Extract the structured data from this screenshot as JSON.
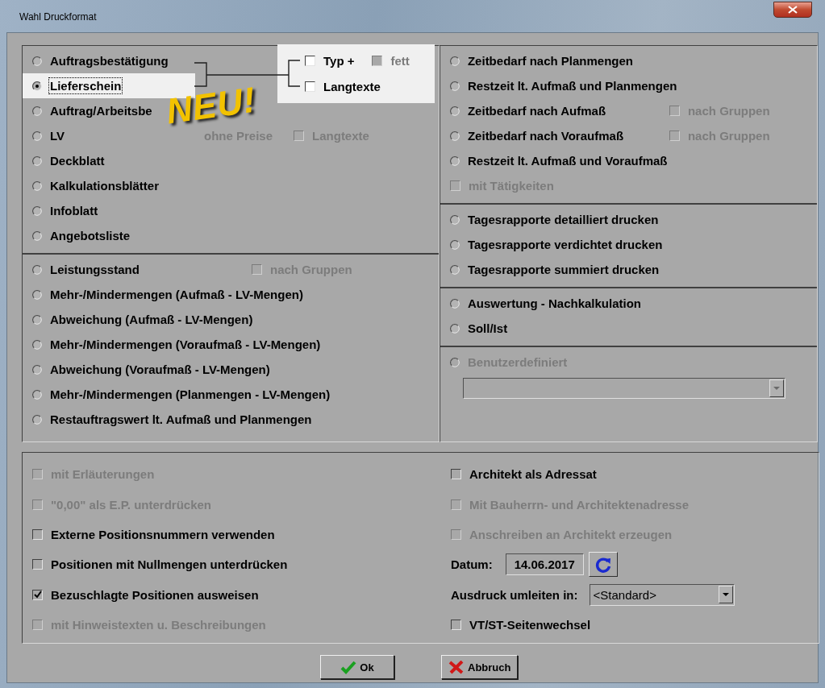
{
  "window": {
    "title": "Wahl Druckformat"
  },
  "left_sections": [
    {
      "rows": [
        {
          "kind": "radio",
          "label": "Auftragsbestätigung",
          "selected": false,
          "focused": false,
          "disabled": false
        },
        {
          "kind": "radio",
          "label": "Lieferschein",
          "selected": true,
          "focused": true,
          "disabled": false
        },
        {
          "kind": "radio",
          "label": "Auftrag/Arbeitsbe",
          "selected": false,
          "focused": false,
          "disabled": false
        },
        {
          "kind": "radio",
          "label": "LV",
          "selected": false,
          "focused": false,
          "disabled": false,
          "extras": [
            {
              "kind": "text",
              "label": "ohne Preise",
              "disabled": true
            },
            {
              "kind": "checkbox",
              "label": "Langtexte",
              "checked": false,
              "disabled": true
            }
          ]
        },
        {
          "kind": "radio",
          "label": "Deckblatt",
          "selected": false,
          "focused": false,
          "disabled": false
        },
        {
          "kind": "radio",
          "label": "Kalkulationsblätter",
          "selected": false,
          "focused": false,
          "disabled": false
        },
        {
          "kind": "radio",
          "label": "Infoblatt",
          "selected": false,
          "focused": false,
          "disabled": false
        },
        {
          "kind": "radio",
          "label": "Angebotsliste",
          "selected": false,
          "focused": false,
          "disabled": false
        }
      ]
    },
    {
      "rows": [
        {
          "kind": "radio",
          "label": "Leistungsstand",
          "selected": false,
          "focused": false,
          "disabled": false,
          "extras": [
            {
              "kind": "checkbox",
              "label": "nach Gruppen",
              "checked": false,
              "disabled": true
            }
          ]
        },
        {
          "kind": "radio",
          "label": "Mehr-/Mindermengen (Aufmaß - LV-Mengen)",
          "selected": false,
          "focused": false,
          "disabled": false
        },
        {
          "kind": "radio",
          "label": "Abweichung (Aufmaß - LV-Mengen)",
          "selected": false,
          "focused": false,
          "disabled": false
        },
        {
          "kind": "radio",
          "label": "Mehr-/Mindermengen (Voraufmaß - LV-Mengen)",
          "selected": false,
          "focused": false,
          "disabled": false
        },
        {
          "kind": "radio",
          "label": "Abweichung (Voraufmaß - LV-Mengen)",
          "selected": false,
          "focused": false,
          "disabled": false
        },
        {
          "kind": "radio",
          "label": "Mehr-/Mindermengen (Planmengen - LV-Mengen)",
          "selected": false,
          "focused": false,
          "disabled": false
        },
        {
          "kind": "radio",
          "label": "Restauftragswert lt. Aufmaß und Planmengen",
          "selected": false,
          "focused": false,
          "disabled": false
        }
      ]
    }
  ],
  "right_sections": [
    {
      "rows": [
        {
          "kind": "radio",
          "label": "Zeitbedarf nach Planmengen",
          "selected": false,
          "focused": false,
          "disabled": false
        },
        {
          "kind": "radio",
          "label": "Restzeit lt. Aufmaß und Planmengen",
          "selected": false,
          "focused": false,
          "disabled": false
        },
        {
          "kind": "radio",
          "label": "Zeitbedarf nach Aufmaß",
          "selected": false,
          "focused": false,
          "disabled": false,
          "extras": [
            {
              "kind": "checkbox",
              "label": "nach Gruppen",
              "checked": false,
              "disabled": true
            }
          ]
        },
        {
          "kind": "radio",
          "label": "Zeitbedarf nach Voraufmaß",
          "selected": false,
          "focused": false,
          "disabled": false,
          "extras": [
            {
              "kind": "checkbox",
              "label": "nach Gruppen",
              "checked": false,
              "disabled": true
            }
          ]
        },
        {
          "kind": "radio",
          "label": "Restzeit lt. Aufmaß und Voraufmaß",
          "selected": false,
          "focused": false,
          "disabled": false
        },
        {
          "kind": "checkbox",
          "label": "mit Tätigkeiten",
          "checked": false,
          "disabled": true
        }
      ]
    },
    {
      "rows": [
        {
          "kind": "radio",
          "label": "Tagesrapporte detailliert drucken",
          "selected": false,
          "focused": false,
          "disabled": false
        },
        {
          "kind": "radio",
          "label": "Tagesrapporte verdichtet drucken",
          "selected": false,
          "focused": false,
          "disabled": false
        },
        {
          "kind": "radio",
          "label": "Tagesrapporte summiert drucken",
          "selected": false,
          "focused": false,
          "disabled": false
        }
      ]
    },
    {
      "rows": [
        {
          "kind": "radio",
          "label": "Auswertung - Nachkalkulation",
          "selected": false,
          "focused": false,
          "disabled": false
        },
        {
          "kind": "radio",
          "label": "Soll/Ist",
          "selected": false,
          "focused": false,
          "disabled": false
        }
      ]
    },
    {
      "rows": [
        {
          "kind": "radio",
          "label": "Benutzerdefiniert",
          "selected": false,
          "focused": false,
          "disabled": true
        },
        {
          "kind": "combo",
          "disabled": true
        }
      ]
    }
  ],
  "callout": {
    "rows": [
      [
        {
          "label": "Typ +",
          "checked": false,
          "disabled": false
        },
        {
          "label": "fett",
          "checked": false,
          "disabled": true
        }
      ],
      [
        {
          "label": "Langtexte",
          "checked": false,
          "disabled": false
        }
      ]
    ]
  },
  "sticker": {
    "text": "NEU!"
  },
  "options_left": [
    {
      "kind": "checkbox",
      "label": "mit Erläuterungen",
      "checked": false,
      "disabled": true
    },
    {
      "kind": "checkbox",
      "label": "\"0,00\" als E.P. unterdrücken",
      "checked": false,
      "disabled": true
    },
    {
      "kind": "checkbox",
      "label": "Externe Positionsnummern verwenden",
      "checked": false,
      "disabled": false
    },
    {
      "kind": "checkbox",
      "label": "Positionen mit Nullmengen unterdrücken",
      "checked": false,
      "disabled": false
    },
    {
      "kind": "checkbox",
      "label": "Bezuschlagte Positionen ausweisen",
      "checked": true,
      "disabled": false
    },
    {
      "kind": "checkbox",
      "label": "mit Hinweistexten u. Beschreibungen",
      "checked": false,
      "disabled": true
    }
  ],
  "options_right": [
    {
      "kind": "checkbox",
      "label": "Architekt als Adressat",
      "checked": false,
      "disabled": false
    },
    {
      "kind": "checkbox",
      "label": "Mit Bauherrn- und Architektenadresse",
      "checked": false,
      "disabled": true
    },
    {
      "kind": "checkbox",
      "label": "Anschreiben an Architekt erzeugen",
      "checked": false,
      "disabled": true
    },
    {
      "kind": "date",
      "label": "Datum:",
      "value": "14.06.2017"
    },
    {
      "kind": "select",
      "label": "Ausdruck umleiten in:",
      "value": "<Standard>"
    },
    {
      "kind": "checkbox",
      "label": "VT/ST-Seitenwechsel",
      "checked": false,
      "disabled": false
    }
  ],
  "buttons": [
    {
      "kind": "ok",
      "label": "Ok"
    },
    {
      "kind": "cancel",
      "label": "Abbruch"
    }
  ]
}
